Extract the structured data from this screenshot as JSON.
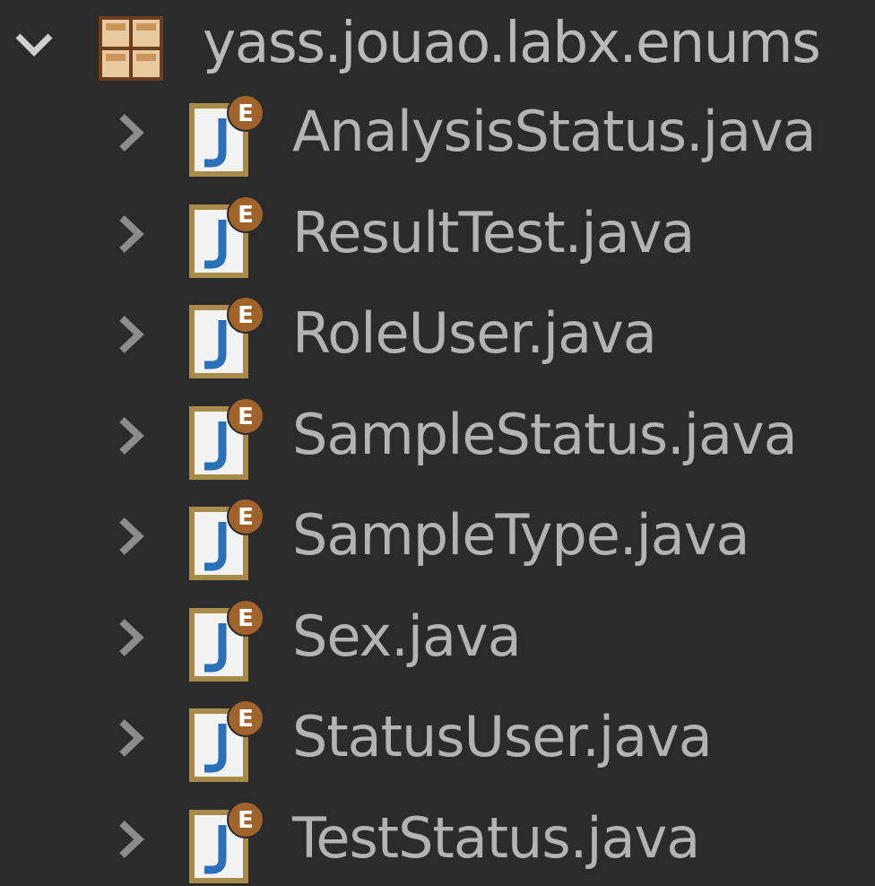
{
  "package": {
    "name": "yass.jouao.labx.enums",
    "expanded": true,
    "toggle_icon": "chevron-down-icon",
    "icon": "package-icon"
  },
  "files": [
    {
      "name": "AnalysisStatus.java",
      "badge": "E",
      "icon": "java-enum-file-icon",
      "toggle_icon": "chevron-right-icon"
    },
    {
      "name": "ResultTest.java",
      "badge": "E",
      "icon": "java-enum-file-icon",
      "toggle_icon": "chevron-right-icon"
    },
    {
      "name": "RoleUser.java",
      "badge": "E",
      "icon": "java-enum-file-icon",
      "toggle_icon": "chevron-right-icon"
    },
    {
      "name": "SampleStatus.java",
      "badge": "E",
      "icon": "java-enum-file-icon",
      "toggle_icon": "chevron-right-icon"
    },
    {
      "name": "SampleType.java",
      "badge": "E",
      "icon": "java-enum-file-icon",
      "toggle_icon": "chevron-right-icon"
    },
    {
      "name": "Sex.java",
      "badge": "E",
      "icon": "java-enum-file-icon",
      "toggle_icon": "chevron-right-icon"
    },
    {
      "name": "StatusUser.java",
      "badge": "E",
      "icon": "java-enum-file-icon",
      "toggle_icon": "chevron-right-icon"
    },
    {
      "name": "TestStatus.java",
      "badge": "E",
      "icon": "java-enum-file-icon",
      "toggle_icon": "chevron-right-icon"
    }
  ],
  "colors": {
    "background": "#2b2b2b",
    "text": "#b3b3b3",
    "chevron": "#8c8c8c",
    "file_border": "#a88b4a",
    "java_j": "#2a6fb8",
    "badge": "#a0632c",
    "package": "#c8955a"
  }
}
